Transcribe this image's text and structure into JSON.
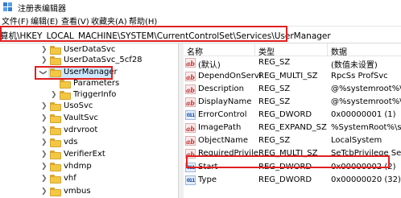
{
  "window": {
    "title": "注册表编辑器"
  },
  "menu": [
    {
      "label": "文件(F)"
    },
    {
      "label": "编辑(E)"
    },
    {
      "label": "查看(V)"
    },
    {
      "label": "收藏夹(A)"
    },
    {
      "label": "帮助(H)"
    }
  ],
  "address": {
    "path": "算机\\HKEY_LOCAL_MACHINE\\SYSTEM\\CurrentControlSet\\Services\\UserManager"
  },
  "tree": {
    "items": [
      {
        "label": "UserDataSvc",
        "expandable": true
      },
      {
        "label": "UserDataSvc_5cf28",
        "expandable": true
      },
      {
        "label": "UserManager",
        "expandable": true,
        "expanded": true,
        "selected": true
      },
      {
        "label": "Parameters",
        "expandable": false
      },
      {
        "label": "TriggerInfo",
        "expandable": true
      },
      {
        "label": "UsoSvc",
        "expandable": true
      },
      {
        "label": "VaultSvc",
        "expandable": true
      },
      {
        "label": "vdrvroot",
        "expandable": true
      },
      {
        "label": "vds",
        "expandable": true
      },
      {
        "label": "VerifierExt",
        "expandable": true
      },
      {
        "label": "vhdmp",
        "expandable": true
      },
      {
        "label": "vhf",
        "expandable": true
      },
      {
        "label": "vmbus",
        "expandable": true
      }
    ]
  },
  "list": {
    "headers": {
      "name": "名称",
      "type": "类型",
      "data": "数据"
    },
    "rows": [
      {
        "icon": "string-value-icon",
        "name": "(默认)",
        "type": "REG_SZ",
        "data": "(数值未设置)"
      },
      {
        "icon": "string-value-icon",
        "name": "DependOnServi...",
        "type": "REG_MULTI_SZ",
        "data": "RpcSs ProfSvc"
      },
      {
        "icon": "string-value-icon",
        "name": "Description",
        "type": "REG_SZ",
        "data": "@%systemroot%\\sys"
      },
      {
        "icon": "string-value-icon",
        "name": "DisplayName",
        "type": "REG_SZ",
        "data": "@%systemroot%\\sys"
      },
      {
        "icon": "binary-value-icon",
        "name": "ErrorControl",
        "type": "REG_DWORD",
        "data": "0x00000001 (1)"
      },
      {
        "icon": "string-value-icon",
        "name": "ImagePath",
        "type": "REG_EXPAND_SZ",
        "data": "%SystemRoot%\\syst"
      },
      {
        "icon": "string-value-icon",
        "name": "ObjectName",
        "type": "REG_SZ",
        "data": "LocalSystem"
      },
      {
        "icon": "string-value-icon",
        "name": "RequiredPrivile...",
        "type": "REG_MULTI_SZ",
        "data": "SeTcbPrivilege SeIm"
      },
      {
        "icon": "binary-value-icon",
        "name": "Start",
        "type": "REG_DWORD",
        "data": "0x00000002 (2)"
      },
      {
        "icon": "binary-value-icon",
        "name": "Type",
        "type": "REG_DWORD",
        "data": "0x00000020 (32)"
      }
    ]
  },
  "colors": {
    "highlight_box": "#e02020",
    "selection": "#cce8ff",
    "folder": "#f2c744"
  }
}
